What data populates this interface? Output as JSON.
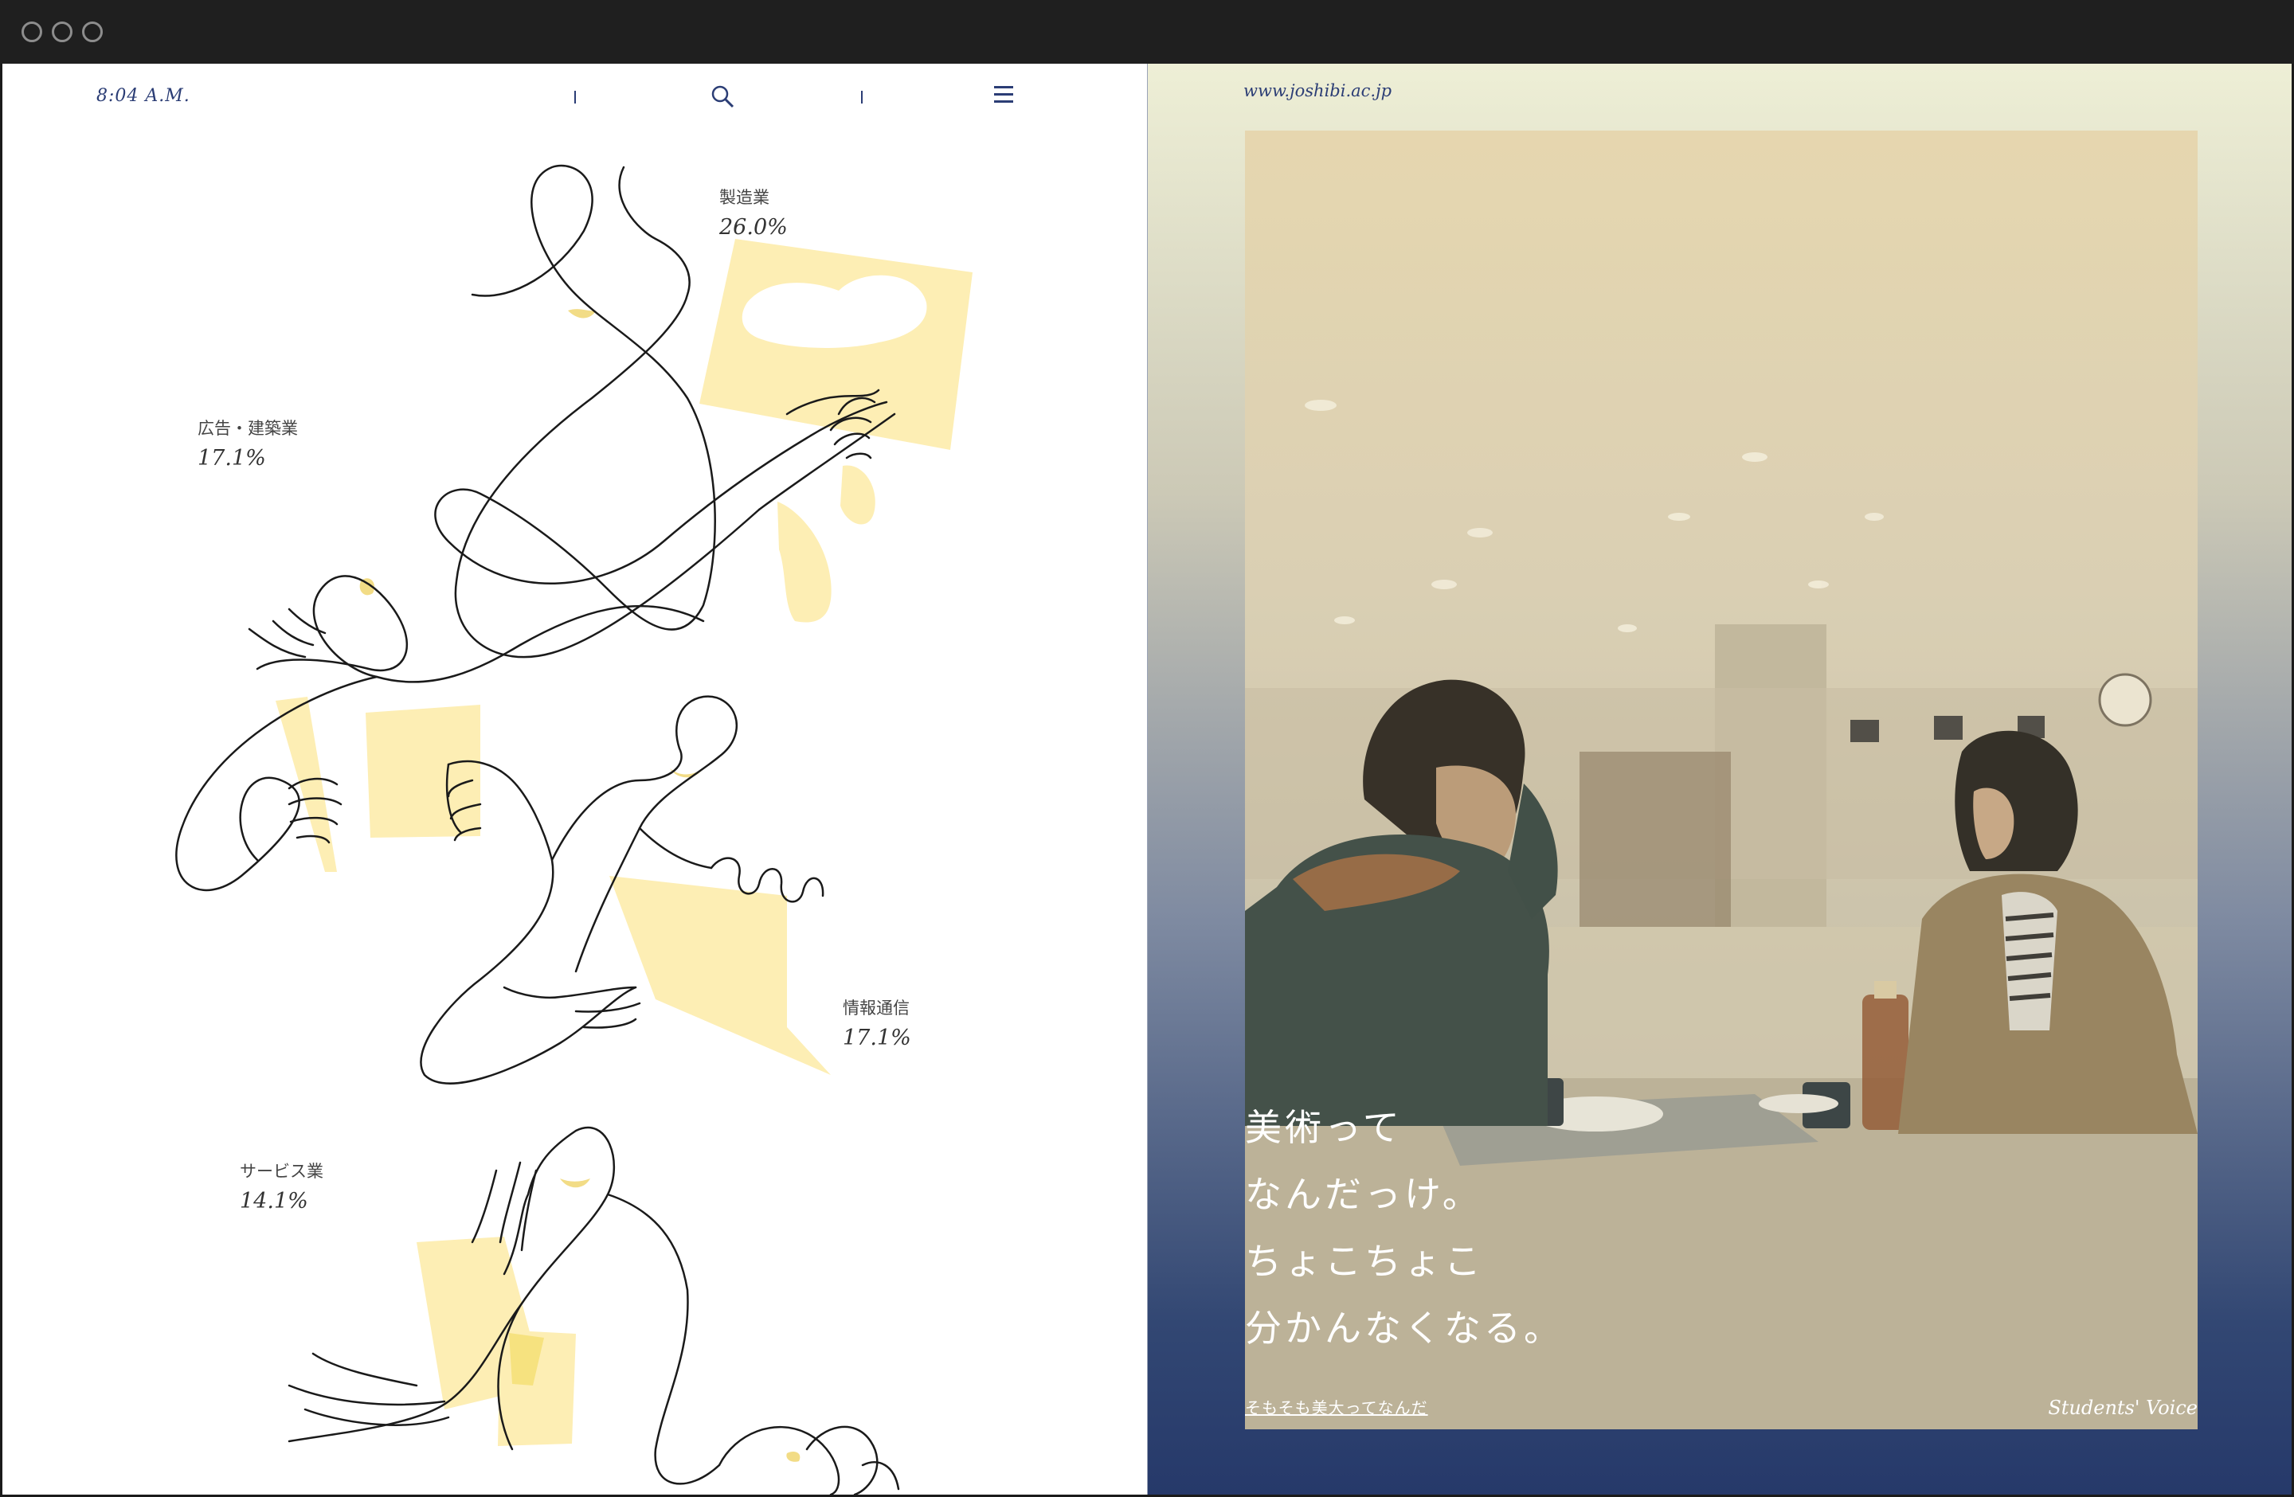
{
  "window": {
    "controls": [
      "close",
      "minimize",
      "maximize"
    ]
  },
  "header": {
    "time": "8:04 A.M.",
    "search_icon": "search-icon",
    "menu_icon": "hamburger-menu-icon"
  },
  "stats": [
    {
      "label": "製造業",
      "value": "26.0%"
    },
    {
      "label": "広告・建築業",
      "value": "17.1%"
    },
    {
      "label": "情報通信",
      "value": "17.1%"
    },
    {
      "label": "サービス業",
      "value": "14.1%"
    }
  ],
  "right": {
    "url": "www.joshibi.ac.jp",
    "headline": [
      "美術って",
      "なんだっけ。",
      "ちょこちょこ",
      "分かんなくなる。"
    ],
    "link": "そもそも美大ってなんだ",
    "tag": "Students' Voice"
  },
  "colors": {
    "accent": "#2b3d75",
    "highlight": "#fdeeb4",
    "line": "#1a1a1a"
  }
}
